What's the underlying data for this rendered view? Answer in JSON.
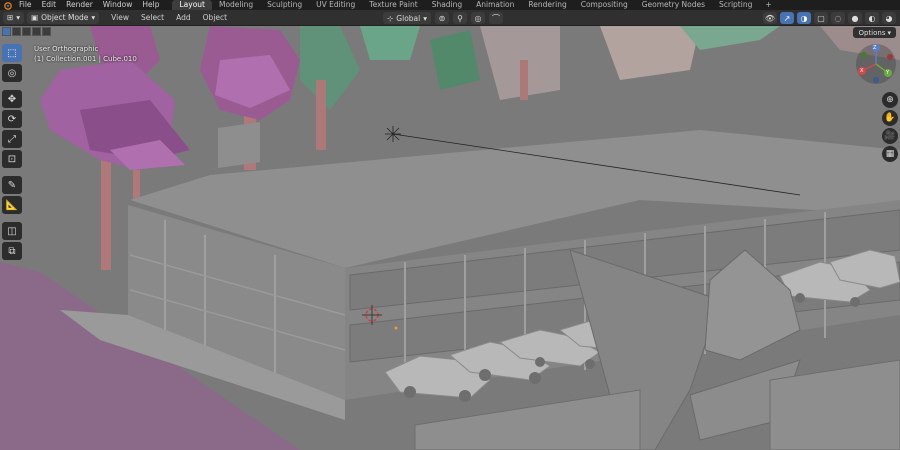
{
  "topbar": {
    "menus": [
      "File",
      "Edit",
      "Render",
      "Window",
      "Help"
    ],
    "workspaces": [
      "Layout",
      "Modeling",
      "Sculpting",
      "UV Editing",
      "Texture Paint",
      "Shading",
      "Animation",
      "Rendering",
      "Compositing",
      "Geometry Nodes",
      "Scripting"
    ],
    "active_workspace": "Layout",
    "add_tab": "+"
  },
  "header": {
    "mode": "Object Mode",
    "menus": [
      "View",
      "Select",
      "Add",
      "Object"
    ],
    "orientation": "Global",
    "options_label": "Options"
  },
  "viewport": {
    "view_name": "User Orthographic",
    "collection_info": "(1) Collection.001 | Cube.010"
  },
  "gizmo": {
    "x": "X",
    "y": "Y",
    "z": "Z"
  },
  "colors": {
    "accent": "#4772b3",
    "ground": "#6a6a6a",
    "tree_pink": "#9a5a92",
    "tree_green": "#5e9478",
    "trunk": "#b07878"
  },
  "icons": {
    "tools": [
      "select-box-icon",
      "cursor-icon",
      "move-icon",
      "rotate-icon",
      "scale-icon",
      "transform-icon",
      "annotate-icon",
      "measure-icon",
      "add-cube-icon",
      "extrude-icon"
    ],
    "nav": [
      "zoom-icon",
      "hand-pan-icon",
      "camera-icon",
      "grid-icon"
    ]
  }
}
